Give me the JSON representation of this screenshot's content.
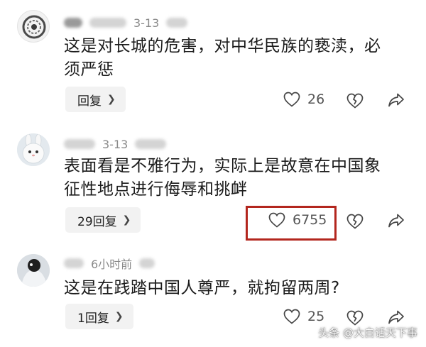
{
  "comments": [
    {
      "date": "3-13",
      "text_line1": "这是对长城的危害，对中华民族的亵渎，必",
      "text_line2": "须严惩",
      "reply_label": "回复",
      "likes": "26"
    },
    {
      "date": "3-13",
      "text_line1": "表面看是不雅行为，实际上是故意在中国象",
      "text_line2": "征性地点进行侮辱和挑衅",
      "reply_label": "29回复",
      "likes": "6755"
    },
    {
      "date": "6小时前",
      "text_line1": "这是在践踏中国人尊严，就拘留两周?",
      "reply_label": "1回复",
      "likes": "25"
    }
  ],
  "icons": {
    "like": "heart-outline-icon",
    "dislike": "broken-heart-icon",
    "share": "share-arrow-icon",
    "reply_chevron": "chevron-right-icon"
  },
  "highlight_color": "#b3261e",
  "watermark": "头条 @大白话天下事"
}
